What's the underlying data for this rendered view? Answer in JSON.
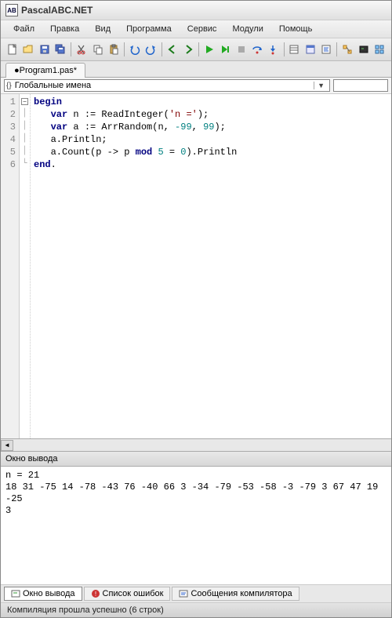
{
  "title": "PascalABC.NET",
  "menu": {
    "items": [
      "Файл",
      "Правка",
      "Вид",
      "Программа",
      "Сервис",
      "Модули",
      "Помощь"
    ]
  },
  "toolbar": {
    "icons": [
      "new-file-icon",
      "open-file-icon",
      "save-icon",
      "save-all-icon",
      "sep",
      "cut-icon",
      "copy-icon",
      "paste-icon",
      "sep",
      "undo-icon",
      "redo-icon",
      "sep",
      "nav-back-icon",
      "nav-forward-icon",
      "sep",
      "run-icon",
      "run-no-debug-icon",
      "stop-icon",
      "step-over-icon",
      "step-into-icon",
      "sep",
      "properties-icon",
      "form-view-icon",
      "code-view-icon",
      "sep",
      "scheme-icon",
      "output-icon",
      "blocks-icon"
    ]
  },
  "tab": {
    "label": "●Program1.pas*"
  },
  "scope": {
    "label": "Глобальные имена"
  },
  "gutter": [
    "1",
    "2",
    "3",
    "4",
    "5",
    "6"
  ],
  "code": {
    "l1": {
      "kw1": "begin"
    },
    "l2": {
      "kw1": "var",
      "id": " n := ReadInteger(",
      "str": "'n ='",
      "tail": ");"
    },
    "l3": {
      "kw1": "var",
      "id": " a := ArrRandom(n, ",
      "n1": "-99",
      "c": ", ",
      "n2": "99",
      "tail": ");"
    },
    "l4": {
      "txt": "a.Println;"
    },
    "l5": {
      "txt1": "a.Count(p -> p ",
      "kw": "mod",
      "txt2": " ",
      "n1": "5",
      "txt3": " = ",
      "n2": "0",
      "txt4": ").Println"
    },
    "l6": {
      "kw1": "end",
      "tail": "."
    }
  },
  "output": {
    "title": "Окно вывода",
    "text": "n = 21\n18 31 -75 14 -78 -43 76 -40 66 3 -34 -79 -53 -58 -3 -79 3 67 47 19 -25\n3"
  },
  "bottom_tabs": {
    "t1": "Окно вывода",
    "t2": "Список ошибок",
    "t3": "Сообщения компилятора"
  },
  "status": "Компиляция прошла успешно (6 строк)"
}
